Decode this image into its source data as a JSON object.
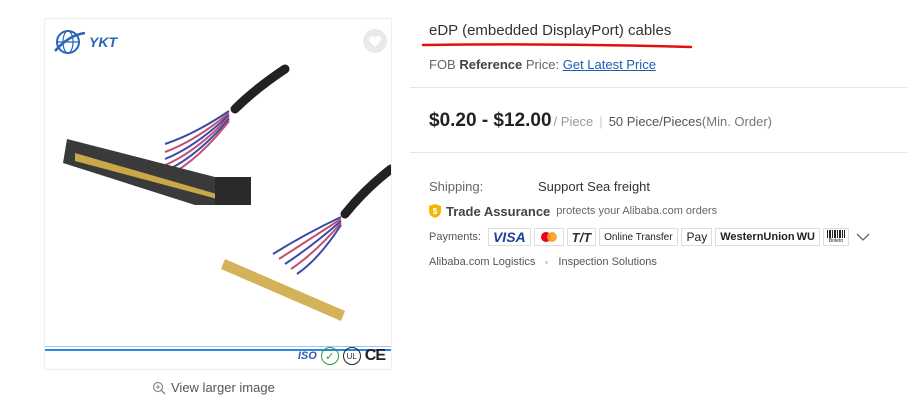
{
  "product": {
    "title": "eDP (embedded DisplayPort) cables",
    "image": {
      "logo_text": "YKT",
      "certs": [
        "ISO",
        "UL",
        "CE"
      ],
      "view_larger": "View larger image"
    }
  },
  "pricing": {
    "fob_prefix": "FOB",
    "fob_reference": "Reference",
    "fob_price_label": "Price:",
    "latest_price_link": "Get Latest Price",
    "price_range": "$0.20 - $12.00",
    "per_unit": "/ Piece",
    "min_order": "50 Piece/Pieces",
    "min_order_note": "(Min. Order)"
  },
  "shipping": {
    "label": "Shipping:",
    "value": "Support Sea freight"
  },
  "trade_assurance": {
    "name": "Trade Assurance",
    "description": "protects your Alibaba.com orders"
  },
  "payments": {
    "label": "Payments:",
    "methods": [
      "VISA",
      "T/T",
      "Online Transfer",
      "Pay",
      "WesternUnion",
      "WU",
      "Boleto"
    ]
  },
  "services": {
    "logistics": "Alibaba.com Logistics",
    "inspection": "Inspection Solutions"
  },
  "colors": {
    "accent_link": "#1a5fb4",
    "underline_mark": "#e01010",
    "image_border_blue": "#2e86de"
  }
}
